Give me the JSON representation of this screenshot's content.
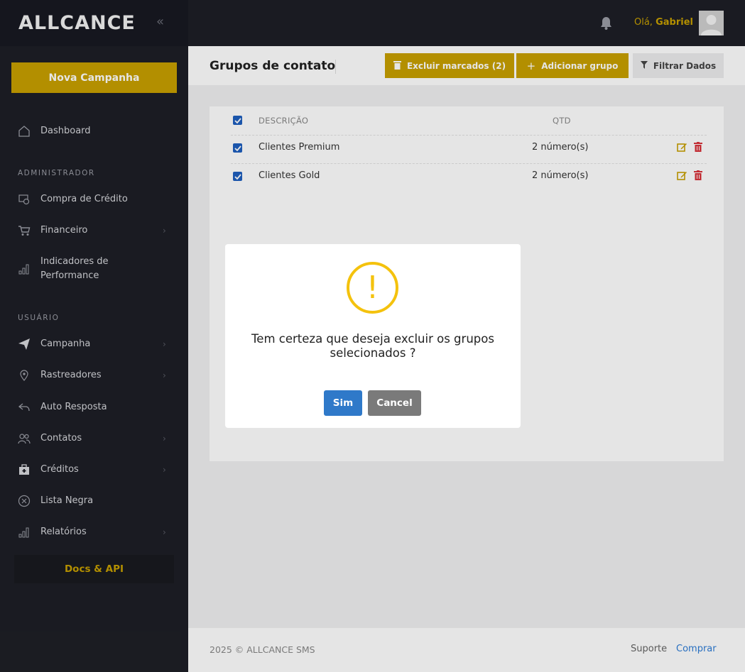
{
  "app": {
    "logo_text": "ALLCANCE"
  },
  "sidebar": {
    "new_campaign": "Nova Campanha",
    "dashboard": "Dashboard",
    "section_admin": "ADMINISTRADOR",
    "admin_items": [
      {
        "label": "Compra de Crédito",
        "icon": "credit-purchase-icon"
      },
      {
        "label": "Financeiro",
        "icon": "cart-icon"
      },
      {
        "label": "Indicadores de Performance",
        "icon": "bar-chart-icon"
      }
    ],
    "section_user": "USUÁRIO",
    "user_items": [
      {
        "label": "Campanha",
        "icon": "send-icon"
      },
      {
        "label": "Rastreadores",
        "icon": "location-pin-icon"
      },
      {
        "label": "Auto Resposta",
        "icon": "reply-icon"
      },
      {
        "label": "Contatos",
        "icon": "users-icon"
      },
      {
        "label": "Créditos",
        "icon": "credit-bag-icon"
      },
      {
        "label": "Lista Negra",
        "icon": "blocked-icon"
      },
      {
        "label": "Relatórios",
        "icon": "report-chart-icon"
      }
    ],
    "docs": "Docs & API"
  },
  "header": {
    "greeting": "Olá,",
    "user_name": "Gabriel"
  },
  "page": {
    "title": "Grupos de contato",
    "delete_marked": "Excluir marcados (2)",
    "add_group": "Adicionar grupo",
    "filter": "Filtrar Dados"
  },
  "table": {
    "col_description": "DESCRIÇÃO",
    "col_qty": "QTD",
    "rows": [
      {
        "description": "Clientes Premium",
        "qty": "2 número(s)",
        "checked": true
      },
      {
        "description": "Clientes Gold",
        "qty": "2 número(s)",
        "checked": true
      }
    ]
  },
  "modal": {
    "icon": "!",
    "message": "Tem certeza que deseja excluir os grupos selecionados ?",
    "confirm": "Sim",
    "cancel": "Cancel"
  },
  "footer": {
    "copyright": "2025 © ALLCANCE SMS",
    "support": "Suporte",
    "buy": "Comprar"
  },
  "colors": {
    "accent": "#c8a000",
    "sidebar": "#1e1f26",
    "primary_blue": "#2f79c9",
    "danger": "#d9343b"
  }
}
